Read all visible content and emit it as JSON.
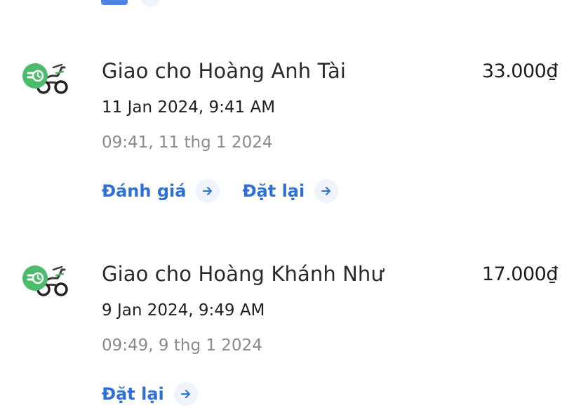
{
  "orders": [
    {
      "title": "Giao cho Hoàng Anh Tài",
      "price": "33.000₫",
      "date_en": "11 Jan 2024, 9:41 AM",
      "date_vi": "09:41, 11 thg 1 2024",
      "actions": [
        "Đánh giá",
        "Đặt lại"
      ],
      "icon": "delivery-bike-icon"
    },
    {
      "title": "Giao cho Hoàng Khánh Như",
      "price": "17.000₫",
      "date_en": "9 Jan 2024, 9:49 AM",
      "date_vi": "09:49, 9 thg 1 2024",
      "actions": [
        "Đặt lại"
      ],
      "icon": "delivery-bike-icon"
    }
  ],
  "colors": {
    "link": "#2f6fd8",
    "badge_green": "#4cbb6c",
    "secondary_text": "#8a8a8a"
  }
}
